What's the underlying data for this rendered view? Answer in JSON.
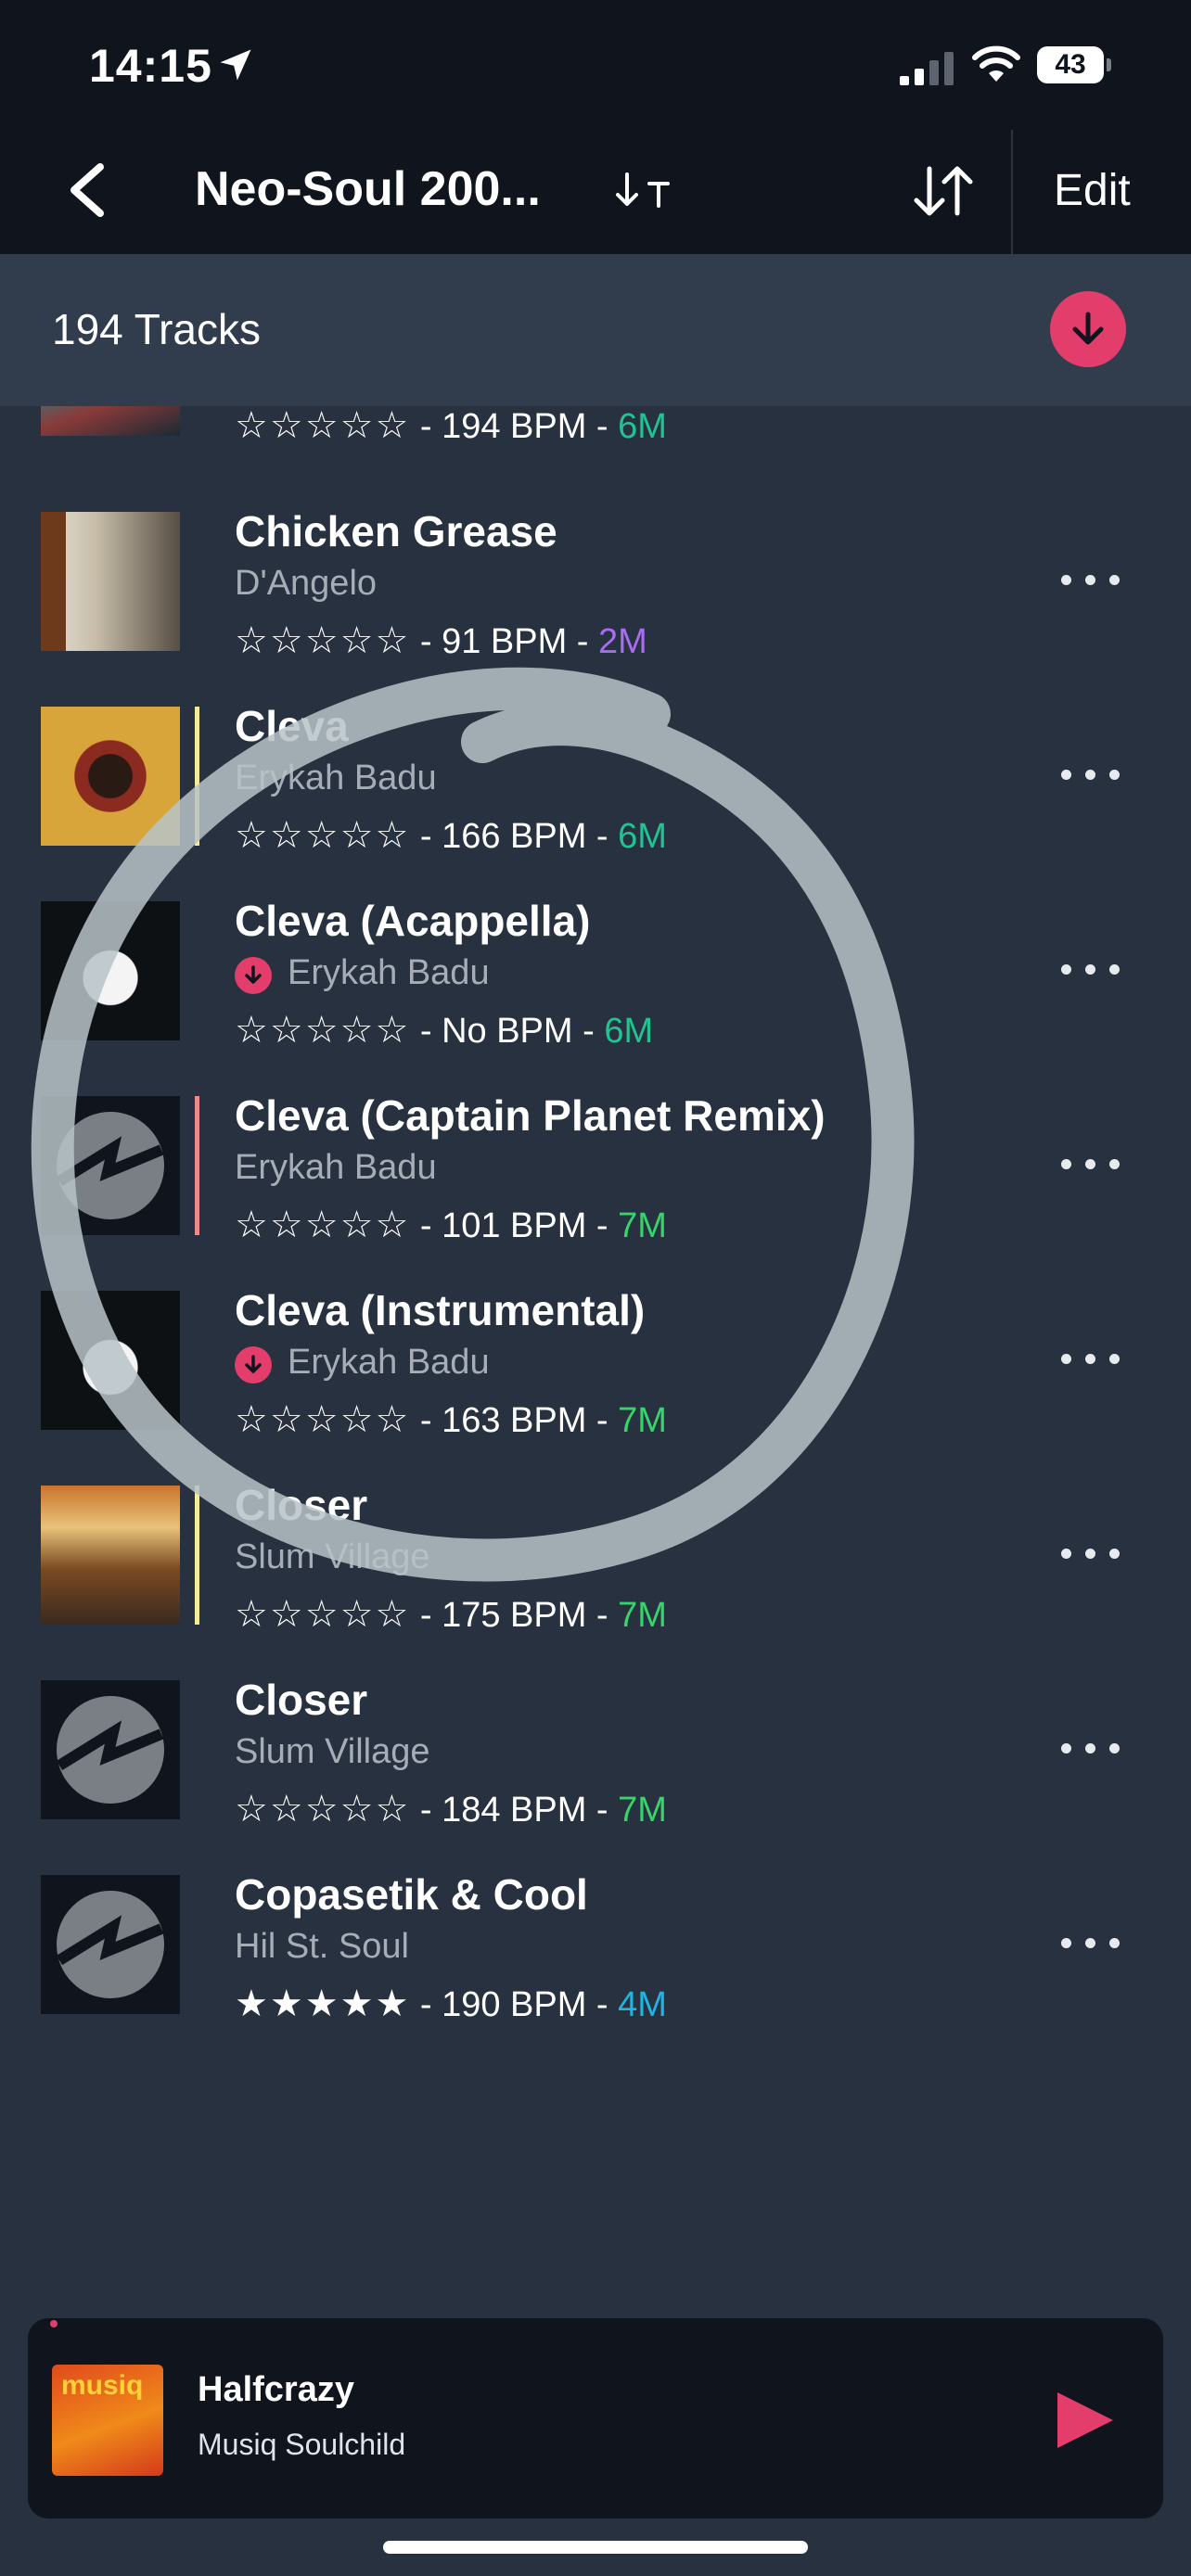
{
  "status_bar": {
    "time": "14:15",
    "battery": "43"
  },
  "nav": {
    "title": "Neo-Soul 200...",
    "sort_az_label": "↓T",
    "edit_label": "Edit"
  },
  "header": {
    "track_count": "194 Tracks"
  },
  "tracks": [
    {
      "title": "",
      "artist": "",
      "stars": "☆☆☆☆☆",
      "bpm": " - 194 BPM - ",
      "duration": "6M",
      "duration_color": "#22c393",
      "accent": "",
      "downloaded": false
    },
    {
      "title": "Chicken Grease",
      "artist": "D'Angelo",
      "stars": "☆☆☆☆☆",
      "bpm": " - 91 BPM - ",
      "duration": "2M",
      "duration_color": "#a86cf0",
      "accent": "",
      "downloaded": false
    },
    {
      "title": "Cleva",
      "artist": "Erykah Badu",
      "stars": "☆☆☆☆☆",
      "bpm": " - 166 BPM - ",
      "duration": "6M",
      "duration_color": "#22c393",
      "accent": "#f2ec9a",
      "downloaded": false
    },
    {
      "title": "Cleva (Acappella)",
      "artist": "Erykah Badu",
      "stars": "☆☆☆☆☆",
      "bpm": " - No BPM - ",
      "duration": "6M",
      "duration_color": "#22c393",
      "accent": "",
      "downloaded": true
    },
    {
      "title": "Cleva (Captain Planet Remix)",
      "artist": "Erykah Badu",
      "stars": "☆☆☆☆☆",
      "bpm": " - 101 BPM - ",
      "duration": "7M",
      "duration_color": "#38d36a",
      "accent": "#f08a8a",
      "downloaded": false
    },
    {
      "title": "Cleva (Instrumental)",
      "artist": "Erykah Badu",
      "stars": "☆☆☆☆☆",
      "bpm": " - 163 BPM - ",
      "duration": "7M",
      "duration_color": "#38d36a",
      "accent": "",
      "downloaded": true
    },
    {
      "title": "Closer",
      "artist": "Slum Village",
      "stars": "☆☆☆☆☆",
      "bpm": " - 175 BPM - ",
      "duration": "7M",
      "duration_color": "#38d36a",
      "accent": "#f2ec9a",
      "downloaded": false
    },
    {
      "title": "Closer",
      "artist": "Slum Village",
      "stars": "☆☆☆☆☆",
      "bpm": " - 184 BPM - ",
      "duration": "7M",
      "duration_color": "#38d36a",
      "accent": "",
      "downloaded": false
    },
    {
      "title": "Copasetik & Cool",
      "artist": "Hil St. Soul",
      "stars": "★★★★★",
      "bpm": " - 190 BPM - ",
      "duration": "4M",
      "duration_color": "#20b4e0",
      "accent": "",
      "downloaded": false
    }
  ],
  "mini_player": {
    "title": "Halfcrazy",
    "artist": "Musiq Soulchild",
    "art_text": "musiq"
  },
  "colors": {
    "accent": "#e23d6b",
    "background": "#27313f",
    "bar": "#10151d"
  }
}
